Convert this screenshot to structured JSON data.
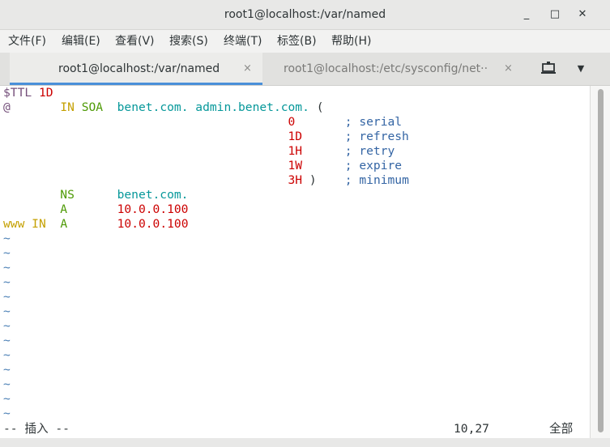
{
  "window": {
    "title": "root1@localhost:/var/named",
    "minimize": "_",
    "maximize": "□",
    "close": "✕"
  },
  "menu": [
    "文件(F)",
    "编辑(E)",
    "查看(V)",
    "搜索(S)",
    "终端(T)",
    "标签(B)",
    "帮助(H)"
  ],
  "tabs": [
    {
      "label": "root1@localhost:/var/named",
      "close": "×"
    },
    {
      "label": "root1@localhost:/etc/sysconfig/net···",
      "close": "×"
    }
  ],
  "file": {
    "l1_a": "$TTL",
    "l1_b": "1D",
    "l2_at": "@",
    "l2_in": "IN",
    "l2_soa": "SOA",
    "l2_ns": "benet.com.",
    "l2_admin": "admin.benet.com.",
    "l2_paren": "(",
    "serial_val": "0",
    "serial_sep": ";",
    "serial_c": "serial",
    "refresh_val": "1D",
    "refresh_sep": ";",
    "refresh_c": "refresh",
    "retry_val": "1H",
    "retry_sep": ";",
    "retry_c": "retry",
    "expire_val": "1W",
    "expire_sep": ";",
    "expire_c": "expire",
    "min_val": "3H",
    "min_paren": ")",
    "min_sep": ";",
    "min_c": "minimum",
    "ns_type": "NS",
    "ns_val": "benet.com.",
    "a_type": "A",
    "a_val": "10.0.0.100",
    "www_name": "www",
    "www_in": "IN",
    "www_type": "A",
    "www_val": "10.0.0.100",
    "tilde": "~"
  },
  "status": {
    "mode": "-- 插入 --",
    "position": "10,27",
    "scope": "全部"
  }
}
